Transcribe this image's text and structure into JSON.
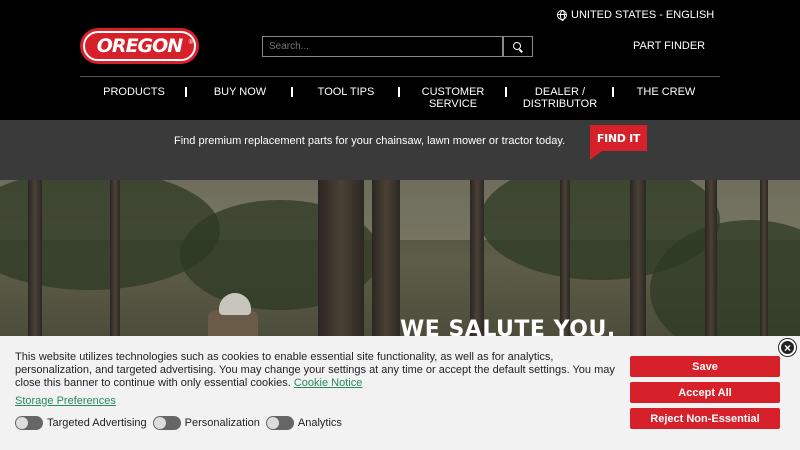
{
  "header": {
    "locale": "UNITED STATES - ENGLISH",
    "logo_text": "OREGON",
    "search_placeholder": "Search...",
    "part_finder": "PART FINDER"
  },
  "nav": {
    "items": [
      {
        "label": "PRODUCTS"
      },
      {
        "label": "BUY NOW"
      },
      {
        "label": "TOOL TIPS"
      },
      {
        "label": "CUSTOMER SERVICE"
      },
      {
        "label": "DEALER / DISTRIBUTOR"
      },
      {
        "label": "THE CREW"
      }
    ]
  },
  "promo": {
    "text": "Find premium replacement parts for your chainsaw, lawn mower or tractor today.",
    "button": "FIND IT"
  },
  "hero": {
    "title": "WE SALUTE YOU."
  },
  "cookie": {
    "text": "This website utilizes technologies such as cookies to enable essential site functionality, as well as for analytics, personalization, and targeted advertising. You may change your settings at any time or accept the default settings. You may close this banner to continue with only essential cookies.",
    "notice_link": "Cookie Notice",
    "storage_link": "Storage Preferences",
    "toggles": [
      {
        "label": "Targeted Advertising"
      },
      {
        "label": "Personalization"
      },
      {
        "label": "Analytics"
      }
    ],
    "save": "Save",
    "accept_all": "Accept All",
    "reject": "Reject Non-Essential",
    "close": "×"
  },
  "colors": {
    "brand_red": "#d6202a",
    "header_bg": "#000000",
    "promo_bg": "#3a3a3a",
    "cookie_bg": "#f2f2f2",
    "link_green": "#2a8a5a"
  }
}
